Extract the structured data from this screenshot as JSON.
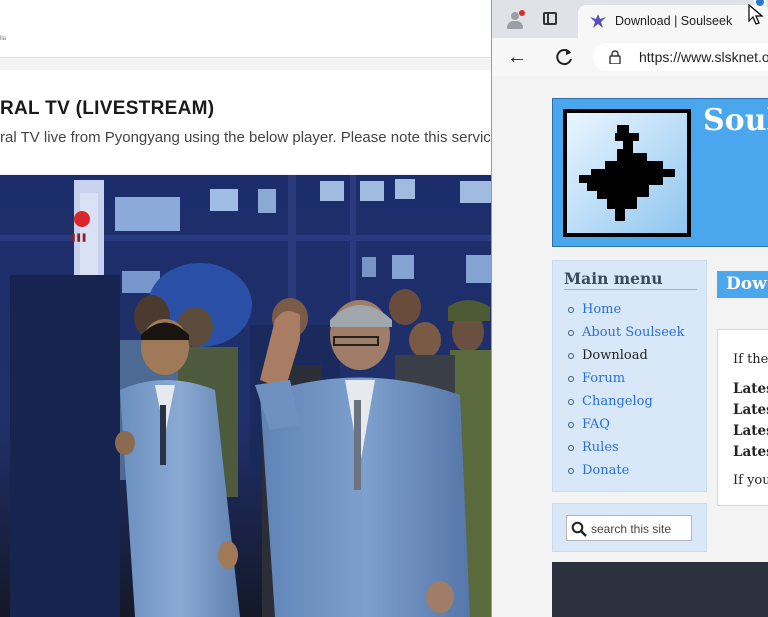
{
  "left_window": {
    "logo_text": "lla",
    "title": "RAL TV (LIVESTREAM)",
    "description": "ral TV live from Pyongyang using the below player. Please note this servic"
  },
  "browser": {
    "tab": {
      "title": "Download | Soulseek"
    },
    "url": "https://www.slsknet.o"
  },
  "page": {
    "site_title": "Soul",
    "menu": {
      "heading": "Main menu",
      "items": [
        {
          "label": "Home",
          "state": "link"
        },
        {
          "label": "About Soulseek",
          "state": "link"
        },
        {
          "label": "Download",
          "state": "current"
        },
        {
          "label": "Forum",
          "state": "link"
        },
        {
          "label": "Changelog",
          "state": "link"
        },
        {
          "label": "FAQ",
          "state": "link"
        },
        {
          "label": "Rules",
          "state": "link"
        },
        {
          "label": "Donate",
          "state": "link"
        }
      ]
    },
    "search": {
      "placeholder": "search this site"
    },
    "content_heading": "Dow",
    "content_lines": [
      "If thes",
      "Lates",
      "Lates",
      "Lates",
      "Lates",
      "If you"
    ]
  },
  "colors": {
    "header_blue": "#4aa7ee",
    "menu_bg": "#d8e8f8",
    "link_blue": "#2a6fd6",
    "footer_dark": "#2c3140",
    "notification_red": "#d93025"
  }
}
